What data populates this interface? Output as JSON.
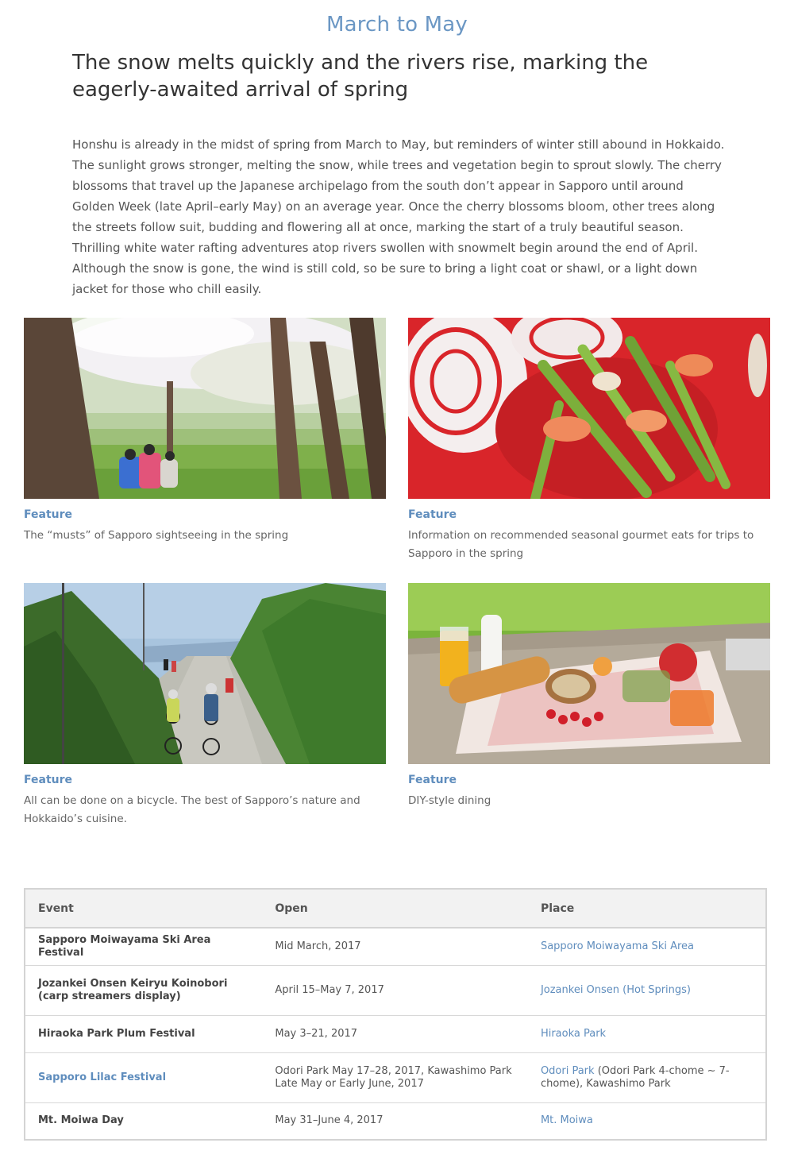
{
  "page": {
    "season_title": "March to May",
    "headline": "The snow melts quickly and the rivers rise, marking the eagerly-awaited arrival of spring",
    "intro": "Honshu is already in the midst of spring from March to May, but reminders of winter still abound in Hokkaido. The sunlight grows stronger, melting the snow, while trees and vegetation begin to sprout slowly. The cherry blossoms that travel up the Japanese archipelago from the south don’t appear in Sapporo until around Golden Week (late April–early May) on an average year. Once the cherry blossoms bloom, other trees along the streets follow suit, budding and flowering all at once, marking the start of a truly beautiful season. Thrilling white water rafting adventures atop rivers swollen with snowmelt begin around the end of April. Although the snow is gone, the wind is still cold, so be sure to bring a light coat or shawl, or a light down jacket for those who chill easily."
  },
  "features": [
    {
      "tag": "Feature",
      "desc": "The “musts” of Sapporo sightseeing in the spring",
      "image": "cherry-blossom-picnic-photo"
    },
    {
      "tag": "Feature",
      "desc": "Information on recommended seasonal gourmet eats for trips to Sapporo in the spring",
      "image": "asparagus-shrimp-dish-photo"
    },
    {
      "tag": "Feature",
      "desc": "All can be done on a bicycle. The best of Sapporo’s nature and Hokkaido’s cuisine.",
      "image": "cyclists-on-road-photo"
    },
    {
      "tag": "Feature",
      "desc": "DIY-style dining",
      "image": "picnic-table-food-photo"
    }
  ],
  "events_table": {
    "headers": [
      "Event",
      "Open",
      "Place"
    ],
    "rows": [
      {
        "event": "Sapporo Moiwayama Ski Area Festival",
        "open": "Mid March, 2017",
        "place_link": "Sapporo Moiwayama Ski Area",
        "place_extra": ""
      },
      {
        "event": "Jozankei Onsen Keiryu Koinobori (carp streamers display)",
        "open": "April 15–May 7, 2017",
        "place_link": "Jozankei Onsen (Hot Springs)",
        "place_extra": ""
      },
      {
        "event": "Hiraoka Park Plum Festival",
        "open": "May 3–21, 2017",
        "place_link": "Hiraoka Park",
        "place_extra": ""
      },
      {
        "event": "Sapporo Lilac Festival",
        "open": "Odori Park May 17–28, 2017, Kawashimo Park Late May or Early June, 2017",
        "place_link": "Odori Park",
        "place_extra": " (Odori Park 4-chome ~ 7-chome), Kawashimo Park"
      },
      {
        "event": "Mt. Moiwa Day",
        "open": "May 31–June 4, 2017",
        "place_link": "Mt. Moiwa",
        "place_extra": ""
      }
    ]
  },
  "colors": {
    "accent": "#5f8dbd",
    "title": "#6b97c4",
    "table_header_bg": "#f2f2f2",
    "border": "#d4d4d4"
  }
}
